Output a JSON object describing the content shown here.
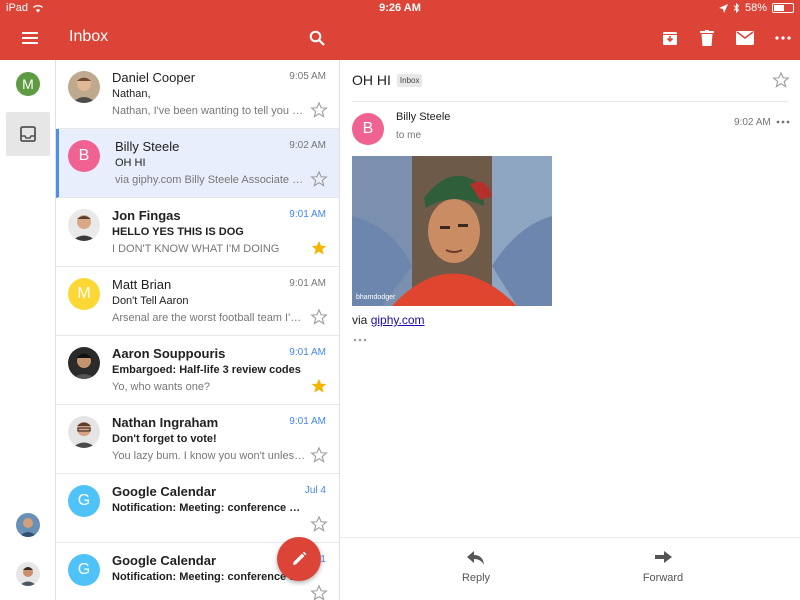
{
  "status_bar": {
    "device": "iPad",
    "time": "9:26 AM",
    "battery": "58%",
    "battery_level": 0.58
  },
  "app_bar": {
    "title": "Inbox",
    "icons": [
      "menu-icon",
      "search-icon",
      "archive-icon",
      "trash-icon",
      "mail-icon",
      "more-icon"
    ]
  },
  "rail": {
    "me_initial": "M"
  },
  "colors": {
    "brand": "#db4437",
    "selected_bg": "#e8eefb",
    "accent_blue": "#4285f4",
    "star_gold": "#f4b400"
  },
  "messages": [
    {
      "sender": "Daniel Cooper",
      "time": "9:05 AM",
      "subject": "Nathan,",
      "snippet": "Nathan, I've been wanting to tell you thi...",
      "starred": false,
      "unread": false,
      "avatar": "photo"
    },
    {
      "sender": "Billy Steele",
      "time": "9:02 AM",
      "subject": "OH HI",
      "snippet": "via giphy.com Billy Steele Associate Edi...",
      "starred": false,
      "unread": false,
      "initial": "B",
      "color": "#f06292"
    },
    {
      "sender": "Jon Fingas",
      "time": "9:01 AM",
      "subject": "HELLO YES THIS IS DOG",
      "snippet": "I DON'T KNOW WHAT I'M DOING",
      "starred": true,
      "unread": true,
      "avatar": "photo"
    },
    {
      "sender": "Matt Brian",
      "time": "9:01 AM",
      "subject": "Don't Tell Aaron",
      "snippet": "Arsenal are the worst football team I've...",
      "starred": false,
      "unread": false,
      "initial": "M",
      "color": "#fdd835"
    },
    {
      "sender": "Aaron Souppouris",
      "time": "9:01 AM",
      "subject": "Embargoed: Half-life 3 review codes",
      "snippet": "Yo, who wants one?",
      "starred": true,
      "unread": true,
      "avatar": "photo"
    },
    {
      "sender": "Nathan Ingraham",
      "time": "9:01 AM",
      "subject": "Don't forget to vote!",
      "snippet": "You lazy bum. I know you won't unless...",
      "starred": false,
      "unread": true,
      "avatar": "photo"
    },
    {
      "sender": "Google Calendar",
      "time": "Jul 4",
      "subject": "Notification: Meeting: conference ro...",
      "snippet": "",
      "starred": false,
      "unread": true,
      "initial": "G",
      "color": "#4fc3f7"
    },
    {
      "sender": "Google Calendar",
      "time": "Jul 1",
      "subject": "Notification: Meeting: conference ro...",
      "snippet": "",
      "starred": false,
      "unread": true,
      "initial": "G",
      "color": "#4fc3f7"
    }
  ],
  "detail": {
    "subject": "OH HI",
    "label": "Inbox",
    "from": "Billy Steele",
    "from_initial": "B",
    "to": "to me",
    "time": "9:02 AM",
    "gif_caption": "bhamdodger",
    "via_prefix": "via",
    "via_link": "giphy.com",
    "reply_label": "Reply",
    "forward_label": "Forward"
  }
}
